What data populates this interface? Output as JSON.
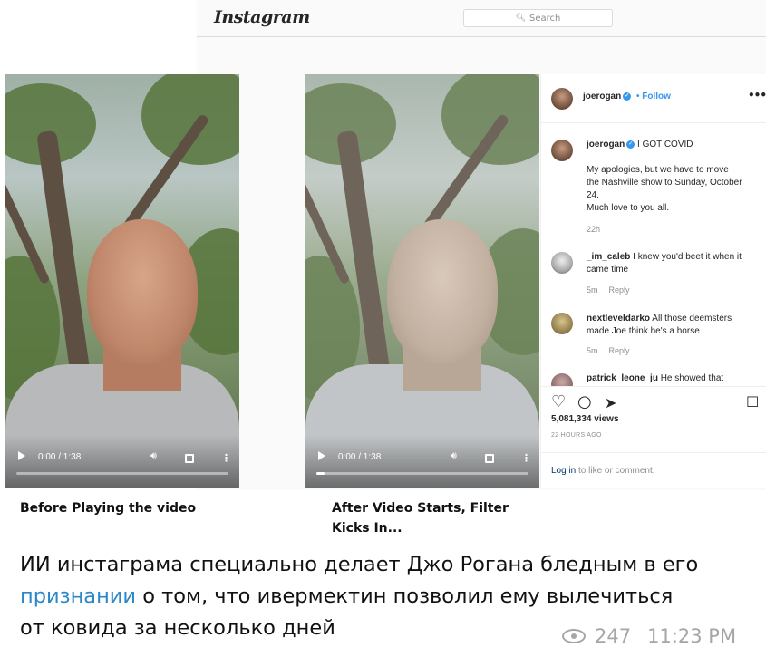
{
  "instagram": {
    "logo": "Instagram",
    "search_placeholder": "Search"
  },
  "video_before": {
    "time": "0:00 / 1:38",
    "progress_fraction": 0.0,
    "label": "Before Playing the video"
  },
  "video_after": {
    "time": "0:00 / 1:38",
    "progress_fraction": 0.04,
    "label_line1": "After Video Starts, Filter",
    "label_line2": "Kicks In..."
  },
  "post": {
    "username": "joerogan",
    "follow_label": "Follow",
    "more_label": "•••",
    "caption": {
      "username": "joerogan",
      "headline": "I GOT COVID",
      "line1": "My apologies, but we have to move",
      "line2": "the Nashville show to Sunday, October",
      "line3": "24.",
      "line4": "Much love to you all.",
      "age": "22h"
    },
    "comments": [
      {
        "username": "_im_caleb",
        "text_line1": "I knew you'd beet it when it",
        "text_line2": "came time",
        "age": "5m",
        "reply": "Reply"
      },
      {
        "username": "nextleveldarko",
        "text_line1": "All those deemsters",
        "text_line2": "made Joe think he's a horse",
        "age": "5m",
        "reply": "Reply"
      },
      {
        "username": "patrick_leone_ju",
        "text_line1": "He showed that",
        "text_line2": "",
        "age": "",
        "reply": ""
      }
    ],
    "views": "5,081,334 views",
    "posted_ago": "22 HOURS AGO",
    "login_link": "Log in",
    "login_suffix": " to like or comment."
  },
  "telegram": {
    "message_part1": "ИИ инстаграма специально делает Джо Рогана бледным в его",
    "message_link": "признании",
    "message_part2": " о том, что ивермектин позволил ему вылечиться",
    "message_part3": "от ковида за несколько дней",
    "views": "247",
    "time": "11:23 PM"
  },
  "colors": {
    "link": "#2b87c8",
    "instagram_blue": "#3897f0",
    "meta_gray": "#a6a6a6"
  }
}
